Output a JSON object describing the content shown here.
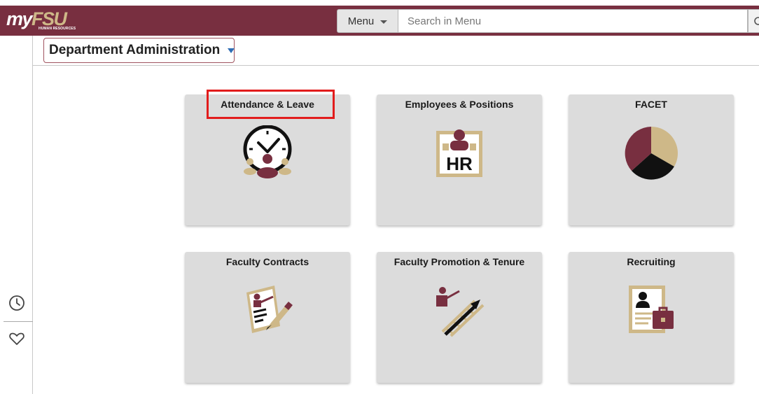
{
  "header": {
    "logo_my": "my",
    "logo_fsu": "FSU",
    "logo_sub": "HUMAN RESOURCES",
    "menu_label": "Menu",
    "search_placeholder": "Search in Menu"
  },
  "nav": {
    "dropdown_label": "Department Administration"
  },
  "sidebar": {
    "icons": [
      "clock-icon",
      "heart-icon"
    ]
  },
  "tiles": [
    {
      "title": "Attendance & Leave",
      "icon": "clock-person-icon"
    },
    {
      "title": "Employees & Positions",
      "icon": "hr-badge-icon"
    },
    {
      "title": "FACET",
      "icon": "pie-chart-icon"
    },
    {
      "title": "Faculty Contracts",
      "icon": "contract-signing-icon"
    },
    {
      "title": "Faculty Promotion & Tenure",
      "icon": "career-ladder-icon"
    },
    {
      "title": "Recruiting",
      "icon": "resume-briefcase-icon"
    }
  ],
  "colors": {
    "garnet": "#782f40",
    "gold": "#ceb888",
    "tile_bg": "#dcdcdc",
    "highlight": "#e21c1c"
  }
}
